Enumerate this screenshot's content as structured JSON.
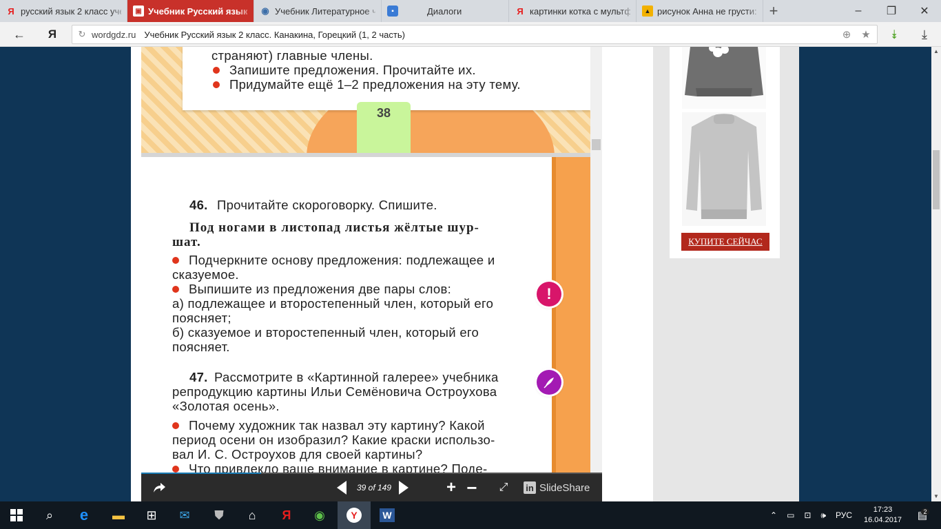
{
  "tabs": [
    {
      "label": "русский язык 2 класс уче",
      "icon": "yandex-icon",
      "active": false
    },
    {
      "label": "Учебник Русский язык",
      "icon": "gdz-icon",
      "active": true
    },
    {
      "label": "Учебник Литературное ч",
      "icon": "book-icon",
      "active": false
    },
    {
      "label": "Диалоги",
      "icon": "chat-icon",
      "active": false
    },
    {
      "label": "картинки котка с мультф",
      "icon": "yandex-icon",
      "active": false
    },
    {
      "label": "рисунок Анна не грусти:",
      "icon": "picture-icon",
      "active": false
    }
  ],
  "nav": {
    "domain": "wordgdz.ru",
    "page_title": "Учебник Русский язык 2 класс. Канакина, Горецкий (1, 2 часть)"
  },
  "slide_top": {
    "line1": "страняют) главные члены.",
    "bullet1": "Запишите предложения. Прочитайте их.",
    "bullet2": "Придумайте ещё 1–2 предложения на эту тему.",
    "page_number": "38"
  },
  "slide_main": {
    "ex46_num": "46.",
    "ex46_title": "Прочитайте скороговорку. Спишите.",
    "tongue_line1": "Под ногами в листопад листья жёлтые шур-",
    "tongue_line2": "шат.",
    "b1_line1": "Подчеркните основу предложения: подлежащее и",
    "b1_line2": "сказуемое.",
    "b2_line1": "Выпишите из предложения две пары слов:",
    "a_line1": "а) подлежащее и второстепенный член, который его",
    "a_line2": "поясняет;",
    "b_line1": "б) сказуемое и второстепенный член, который его",
    "b_line2": "поясняет.",
    "ex47_num": "47.",
    "ex47_line1": "Рассмотрите в «Картинной галерее» учебника",
    "ex47_line2": "репродукцию картины Ильи Семёновича Остроухова",
    "ex47_line3": "«Золотая осень».",
    "q_line1": "Почему художник так назвал эту картину? Какой",
    "q_line2": "период осени он изобразил? Какие краски использо-",
    "q_line3": "вал И. С. Остроухов для своей картины?",
    "q2_line1": "Что привлекло ваше внимание в картине? Поде-",
    "badge1": "!"
  },
  "viewer": {
    "counter": "39 of 149",
    "brand": "SlideShare",
    "progress": 0.26
  },
  "ad": {
    "buy_label": "КУПИТЕ СЕЙЧАС"
  },
  "taskbar": {
    "lang": "РУС",
    "time": "17:23",
    "date": "16.04.2017",
    "notif_count": "2"
  }
}
